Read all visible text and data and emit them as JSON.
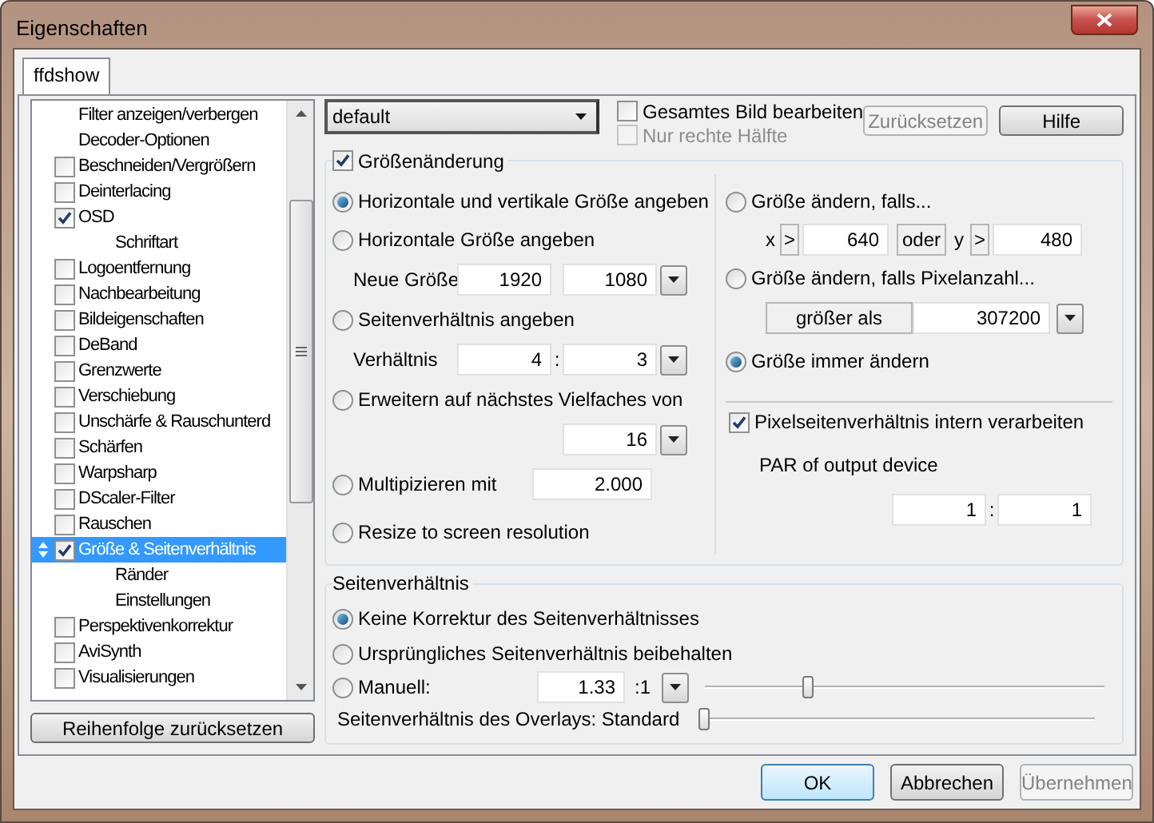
{
  "window": {
    "title": "Eigenschaften"
  },
  "tabs": [
    {
      "label": "ffdshow",
      "selected": true
    }
  ],
  "filter_list": {
    "items": [
      {
        "kind": "plain",
        "label": "Filter anzeigen/verbergen",
        "selected": false
      },
      {
        "kind": "plain",
        "label": "Decoder-Optionen",
        "selected": false
      },
      {
        "kind": "check",
        "label": "Beschneiden/Vergrößern",
        "checked": false,
        "selected": false
      },
      {
        "kind": "check",
        "label": "Deinterlacing",
        "checked": false,
        "selected": false
      },
      {
        "kind": "check",
        "label": "OSD",
        "checked": true,
        "selected": false,
        "children": [
          {
            "kind": "plain",
            "label": "Schriftart",
            "selected": false
          }
        ]
      },
      {
        "kind": "check",
        "label": "Logoentfernung",
        "checked": false,
        "selected": false
      },
      {
        "kind": "check",
        "label": "Nachbearbeitung",
        "checked": false,
        "selected": false
      },
      {
        "kind": "check",
        "label": "Bildeigenschaften",
        "checked": false,
        "selected": false
      },
      {
        "kind": "check",
        "label": "DeBand",
        "checked": false,
        "selected": false
      },
      {
        "kind": "check",
        "label": "Grenzwerte",
        "checked": false,
        "selected": false
      },
      {
        "kind": "check",
        "label": "Verschiebung",
        "checked": false,
        "selected": false
      },
      {
        "kind": "check",
        "label": "Unschärfe & Rauschunterd",
        "checked": false,
        "selected": false
      },
      {
        "kind": "check",
        "label": "Schärfen",
        "checked": false,
        "selected": false
      },
      {
        "kind": "check",
        "label": "Warpsharp",
        "checked": false,
        "selected": false
      },
      {
        "kind": "check",
        "label": "DScaler-Filter",
        "checked": false,
        "selected": false
      },
      {
        "kind": "check",
        "label": "Rauschen",
        "checked": false,
        "selected": false
      },
      {
        "kind": "check",
        "label": "Größe & Seitenverhältnis",
        "checked": true,
        "selected": true,
        "children": [
          {
            "kind": "plain",
            "label": "Ränder",
            "selected": false
          },
          {
            "kind": "plain",
            "label": "Einstellungen",
            "selected": false
          }
        ]
      },
      {
        "kind": "check",
        "label": "Perspektivenkorrektur",
        "checked": false,
        "selected": false
      },
      {
        "kind": "check",
        "label": "AviSynth",
        "checked": false,
        "selected": false
      },
      {
        "kind": "check",
        "label": "Visualisierungen",
        "checked": false,
        "selected": false
      }
    ]
  },
  "reset_order_button": {
    "label": "Reihenfolge zurücksetzen"
  },
  "preset": {
    "value": "default"
  },
  "options": [
    {
      "label": "Gesamtes Bild bearbeiten",
      "checked": false,
      "disabled": false
    },
    {
      "label": "Nur rechte Hälfte",
      "checked": false,
      "disabled": true
    }
  ],
  "top_buttons": [
    {
      "label": "Zurücksetzen",
      "disabled": true
    },
    {
      "label": "Hilfe",
      "disabled": false
    }
  ],
  "resize": {
    "title": "Größenänderung",
    "checked": true,
    "left_rows": [
      {
        "kind": "radio",
        "label": "Horizontale und vertikale Größe angeben",
        "selected": true
      },
      {
        "kind": "radio",
        "label": "Horizontale Größe angeben",
        "selected": false
      },
      {
        "kind": "pair",
        "label": "Neue Größe",
        "values": [
          "1920",
          "1080"
        ]
      },
      {
        "kind": "radio",
        "label": "Seitenverhältnis angeben",
        "selected": false
      },
      {
        "kind": "pair",
        "label": "Verhältnis",
        "values": [
          "4",
          "3"
        ],
        "separator": ":"
      },
      {
        "kind": "radio",
        "label": "Erweitern auf nächstes Vielfaches von",
        "selected": false
      },
      {
        "kind": "single",
        "value": "16"
      },
      {
        "kind": "radio",
        "label": "Multipizieren mit",
        "selected": false,
        "value": "2.000"
      },
      {
        "kind": "radio",
        "label": "Resize to screen resolution",
        "selected": false
      }
    ],
    "right_rows": [
      {
        "kind": "radio",
        "label": "Größe ändern, falls...",
        "selected": false
      },
      {
        "kind": "condition",
        "x_label": "x",
        "x_op": ">",
        "x_value": "640",
        "join": "oder",
        "y_label": "y",
        "y_op": ">",
        "y_value": "480"
      },
      {
        "kind": "radio",
        "label": "Größe ändern, falls Pixelanzahl...",
        "selected": false
      },
      {
        "kind": "pixel_count",
        "op": "größer als",
        "value": "307200"
      },
      {
        "kind": "radio",
        "label": "Größe immer ändern",
        "selected": true
      },
      {
        "kind": "check",
        "label": "Pixelseitenverhältnis intern verarbeiten",
        "checked": true
      },
      {
        "kind": "label",
        "label": "PAR of output device"
      },
      {
        "kind": "pair",
        "values": [
          "1",
          "1"
        ],
        "separator": ":"
      }
    ]
  },
  "aspect": {
    "title": "Seitenverhältnis",
    "rows": [
      {
        "kind": "radio",
        "label": "Keine Korrektur des Seitenverhältnisses",
        "selected": true
      },
      {
        "kind": "radio",
        "label": "Ursprüngliches Seitenverhältnis beibehalten",
        "selected": false
      },
      {
        "kind": "manual",
        "label": "Manuell:",
        "selected": false,
        "value": "1.33",
        "suffix": ":1",
        "level": 0.25
      },
      {
        "kind": "slider",
        "label": "Seitenverhältnis des Overlays: Standard",
        "level": 0
      }
    ]
  },
  "dialog_buttons": [
    {
      "label": "OK",
      "default": true,
      "disabled": false
    },
    {
      "label": "Abbrechen",
      "default": false,
      "disabled": false
    },
    {
      "label": "Übernehmen",
      "default": false,
      "disabled": true
    }
  ]
}
